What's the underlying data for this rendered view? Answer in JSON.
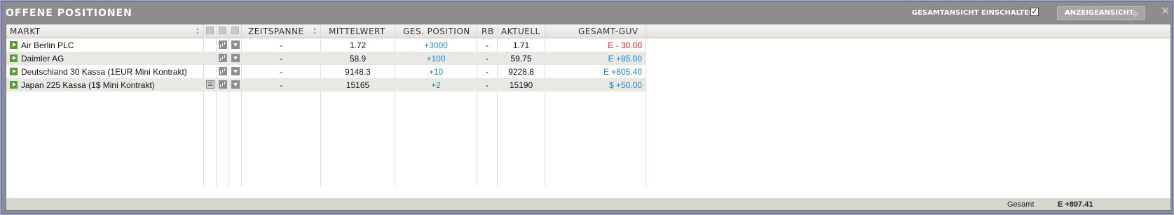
{
  "window": {
    "title": "OFFENE POSITIONEN",
    "gesamtansicht_label": "GESAMTANSICHT EINSCHALTEN",
    "gesamtansicht_checked": "✓",
    "anzeige_button": "ANZEIGEANSICHT",
    "close": "✕"
  },
  "columns": {
    "markt": "MARKT",
    "zeitspanne": "ZEITSPANNE",
    "mittelwert": "MITTELWERT",
    "ges_position": "GES. POSITION",
    "rb": "RB",
    "aktuell": "AKTUELL",
    "gesamt_guv": "GESAMT-GUV"
  },
  "rows": [
    {
      "markt": "Air Berlin PLC",
      "zeitspanne": "-",
      "mittelwert": "1.72",
      "position": "+3000",
      "rb": "-",
      "aktuell": "1.71",
      "guv": "E - 30.00",
      "guv_sign": "negative",
      "has_detail": false
    },
    {
      "markt": "Daimler AG",
      "zeitspanne": "-",
      "mittelwert": "58.9",
      "position": "+100",
      "rb": "-",
      "aktuell": "59.75",
      "guv": "E +85.00",
      "guv_sign": "positive",
      "has_detail": false
    },
    {
      "markt": "Deutschland 30 Kassa (1EUR Mini Kontrakt)",
      "zeitspanne": "-",
      "mittelwert": "9148.3",
      "position": "+10",
      "rb": "-",
      "aktuell": "9228.8",
      "guv": "E +805.40",
      "guv_sign": "positive",
      "has_detail": false
    },
    {
      "markt": "Japan 225 Kassa (1$ Mini Kontrakt)",
      "zeitspanne": "-",
      "mittelwert": "15165",
      "position": "+2",
      "rb": "-",
      "aktuell": "15190",
      "guv": "$ +50.00",
      "guv_sign": "positive",
      "has_detail": true
    }
  ],
  "footer": {
    "label": "Gesamt",
    "value": "E +897.41"
  },
  "colors": {
    "positive": "#1d87c9",
    "negative": "#dd1a1a",
    "market_play": "#5a9a32"
  }
}
